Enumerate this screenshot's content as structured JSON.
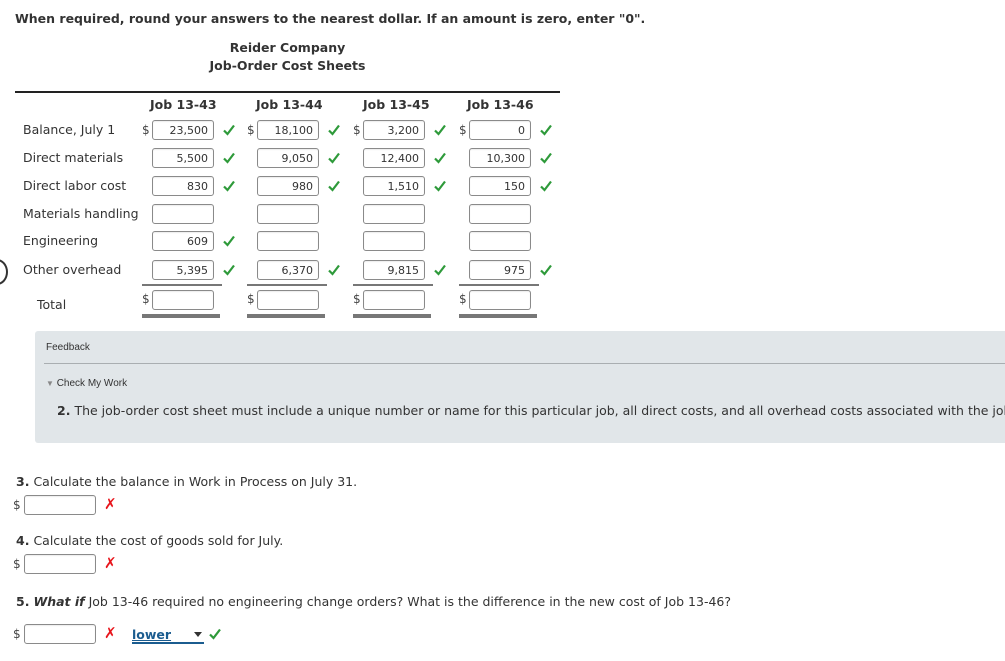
{
  "instruction": "When required, round your answers to the nearest dollar. If an amount is zero, enter \"0\".",
  "company": "Reider Company",
  "sheet_title": "Job-Order Cost Sheets",
  "currency_symbol": "$",
  "columns": [
    "Job 13-43",
    "Job 13-44",
    "Job 13-45",
    "Job 13-46"
  ],
  "rows": [
    {
      "label": "Balance, July 1",
      "values": [
        "23,500",
        "18,100",
        "3,200",
        "0"
      ],
      "status": [
        "correct",
        "correct",
        "correct",
        "correct"
      ]
    },
    {
      "label": "Direct materials",
      "values": [
        "5,500",
        "9,050",
        "12,400",
        "10,300"
      ],
      "status": [
        "correct",
        "correct",
        "correct",
        "correct"
      ]
    },
    {
      "label": "Direct labor cost",
      "values": [
        "830",
        "980",
        "1,510",
        "150"
      ],
      "status": [
        "correct",
        "correct",
        "correct",
        "correct"
      ]
    },
    {
      "label": "Materials handling",
      "values": [
        "",
        "",
        "",
        ""
      ],
      "status": [
        "",
        "",
        "",
        ""
      ]
    },
    {
      "label": "Engineering",
      "values": [
        "609",
        "",
        "",
        ""
      ],
      "status": [
        "correct",
        "",
        "",
        ""
      ]
    },
    {
      "label": "Other overhead",
      "values": [
        "5,395",
        "6,370",
        "9,815",
        "975"
      ],
      "status": [
        "correct",
        "correct",
        "correct",
        "correct"
      ]
    }
  ],
  "total": {
    "label": "Total",
    "values": [
      "",
      "",
      "",
      ""
    ]
  },
  "feedback": {
    "title": "Feedback",
    "check_label": "Check My Work",
    "number": "2.",
    "text": "The job-order cost sheet must include a unique number or name for this particular job, all direct costs, and all overhead costs associated with the job."
  },
  "q3": {
    "number": "3.",
    "text": "Calculate the balance in Work in Process on July 31.",
    "value": "",
    "status": "incorrect"
  },
  "q4": {
    "number": "4.",
    "text": "Calculate the cost of goods sold for July.",
    "value": "",
    "status": "incorrect"
  },
  "q5": {
    "number": "5.",
    "emph": "What if",
    "text": "Job 13-46 required no engineering change orders? What is the difference in the new cost of Job 13-46?",
    "value": "",
    "status": "incorrect",
    "select_value": "lower",
    "select_status": "correct"
  },
  "colors": {
    "correct": "#2e9a3a",
    "incorrect": "#e8141b",
    "feedback_bg": "#e1e6e9",
    "link": "#1b5c8f"
  }
}
